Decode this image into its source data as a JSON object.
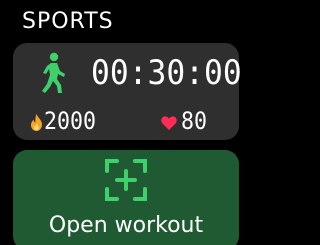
{
  "screen": {
    "title": "SPORTS"
  },
  "stats": {
    "duration": "00:30:00",
    "calories": "2000",
    "heart_rate": "80",
    "icons": {
      "activity": "walking-person-icon",
      "calories": "flame-icon",
      "heart_rate": "heart-icon"
    }
  },
  "workout": {
    "label": "Open workout",
    "icon": "add-workout-icon"
  },
  "colors": {
    "background": "#000000",
    "stats_card": "#2f2f2f",
    "workout_card": "#1f5a32",
    "accent_green": "#3ed16b",
    "flame_orange": "#f5a623",
    "heart_red": "#ff2d55",
    "text": "#ffffff"
  }
}
